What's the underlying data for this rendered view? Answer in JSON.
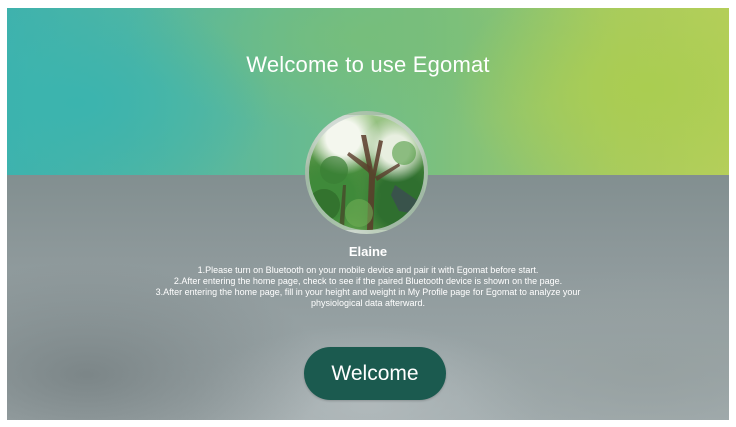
{
  "screen": {
    "title": "Welcome to use Egomat",
    "username": "Elaine",
    "instructions": [
      "1.Please turn on Bluetooth on your mobile device and pair it with Egomat before start.",
      "2.After entering the home page, check to see if the paired Bluetooth device is shown on the page.",
      "3.After entering the home page, fill in your height and weight in My Profile page for Egomat to analyze your physiological data afterward."
    ],
    "welcome_button_label": "Welcome"
  },
  "colors": {
    "top_left": "#3fb2ad",
    "top_right": "#b7cf5c",
    "bottom": "#8e999b",
    "button": "#1b5a4f",
    "text": "#ffffff"
  }
}
